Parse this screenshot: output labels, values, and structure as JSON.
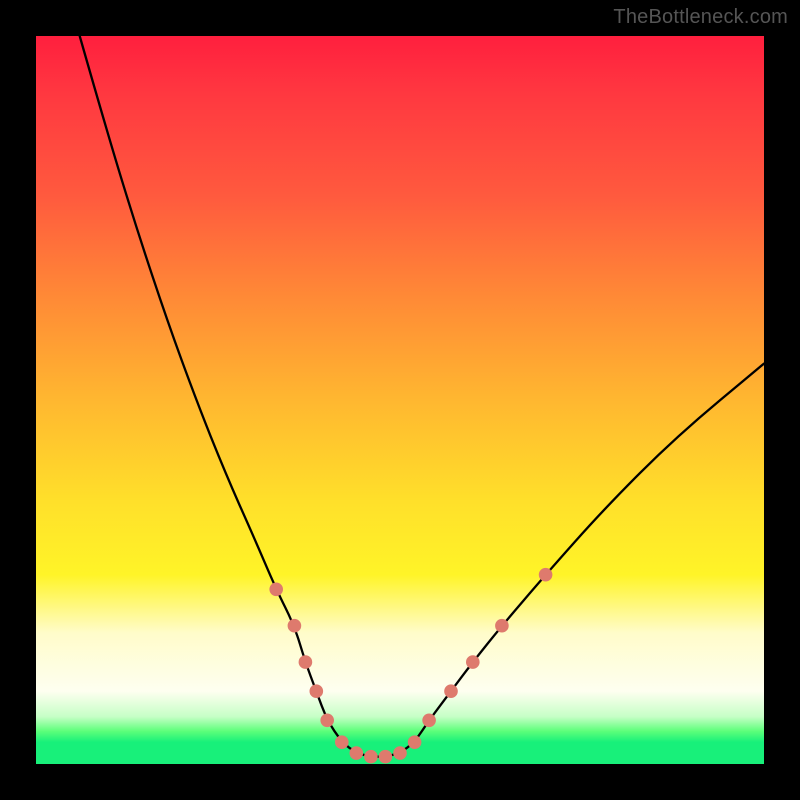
{
  "watermark": "TheBottleneck.com",
  "chart_data": {
    "type": "line",
    "title": "",
    "xlabel": "",
    "ylabel": "",
    "xlim": [
      0,
      100
    ],
    "ylim": [
      0,
      100
    ],
    "grid": false,
    "legend": false,
    "background": "vertical rainbow gradient (red top to green bottom)",
    "series": [
      {
        "name": "bottleneck-curve",
        "x": [
          6,
          10,
          14,
          18,
          22,
          26,
          30,
          33,
          35.5,
          37,
          38.5,
          40,
          42,
          44,
          46,
          48,
          50,
          52,
          54,
          57,
          60,
          64,
          70,
          78,
          88,
          100
        ],
        "values": [
          100,
          86,
          73,
          61,
          50,
          40,
          31,
          24,
          19,
          14,
          10,
          6,
          3,
          1.5,
          1,
          1,
          1.5,
          3,
          6,
          10,
          14,
          19,
          26,
          35,
          45,
          55
        ]
      }
    ],
    "markers": {
      "name": "highlighted-points",
      "color": "#de7a6d",
      "radius_px": 6.8,
      "points": [
        {
          "x": 33,
          "y": 24
        },
        {
          "x": 35.5,
          "y": 19
        },
        {
          "x": 37,
          "y": 14
        },
        {
          "x": 38.5,
          "y": 10
        },
        {
          "x": 40,
          "y": 6
        },
        {
          "x": 42,
          "y": 3
        },
        {
          "x": 44,
          "y": 1.5
        },
        {
          "x": 46,
          "y": 1
        },
        {
          "x": 48,
          "y": 1
        },
        {
          "x": 50,
          "y": 1.5
        },
        {
          "x": 52,
          "y": 3
        },
        {
          "x": 54,
          "y": 6
        },
        {
          "x": 57,
          "y": 10
        },
        {
          "x": 60,
          "y": 14
        },
        {
          "x": 64,
          "y": 19
        },
        {
          "x": 70,
          "y": 26
        }
      ]
    }
  }
}
